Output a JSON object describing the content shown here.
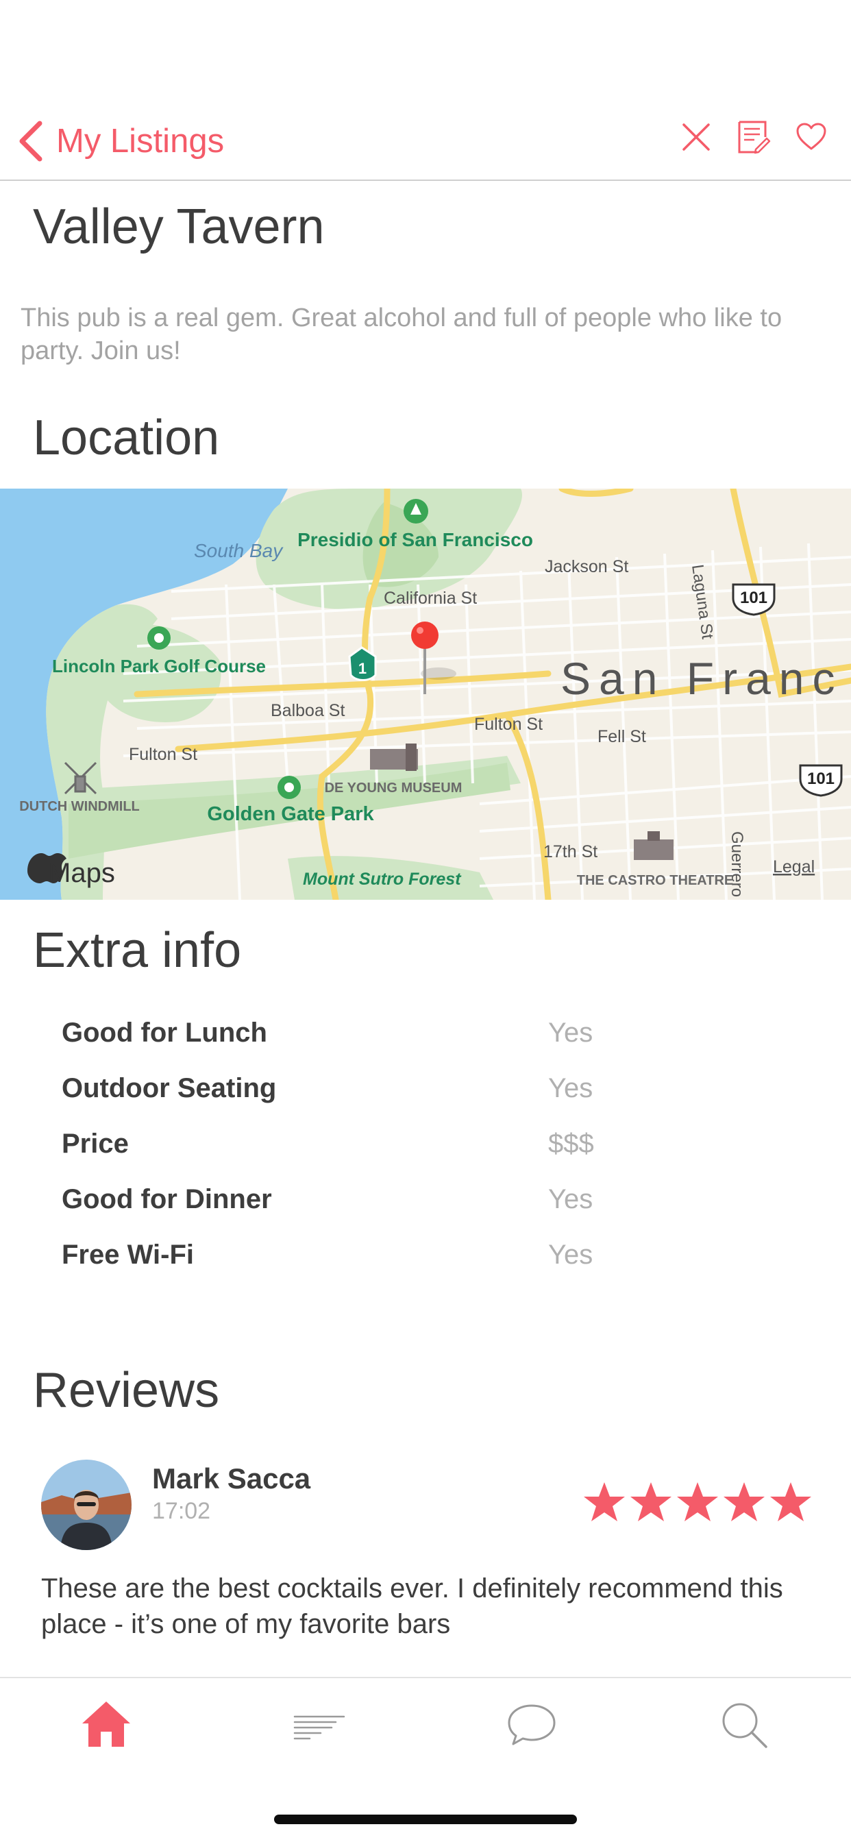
{
  "nav": {
    "back_label": "My Listings",
    "icons": [
      "close-icon",
      "edit-listing-icon",
      "heart-icon"
    ],
    "accent_color": "#f45b69"
  },
  "listing": {
    "title": "Valley Tavern",
    "description": "This pub is a real gem. Great alcohol and full of people who like to party. Join us!"
  },
  "sections": {
    "location": "Location",
    "extra_info": "Extra info",
    "reviews": "Reviews"
  },
  "map": {
    "labels": {
      "south_bay": "South Bay",
      "presidio": "Presidio of San Francisco",
      "jackson": "Jackson St",
      "california": "California St",
      "laguna": "Laguna St",
      "lincoln_park": "Lincoln Park Golf Course",
      "balboa": "Balboa St",
      "san_francisco": "San Franc",
      "fulton_right": "Fulton St",
      "fell": "Fell St",
      "fulton_left": "Fulton St",
      "dutch_windmill": "DUTCH WINDMILL",
      "de_young": "DE YOUNG MUSEUM",
      "golden_gate_park": "Golden Gate Park",
      "seventeenth": "17th St",
      "castro": "THE CASTRO THEATRE",
      "guerrero": "Guerrero",
      "mount_sutro": "Mount Sutro Forest",
      "maps_brand": "Maps",
      "legal": "Legal",
      "route_1": "1",
      "route_101_top": "101",
      "route_101_bottom": "101"
    }
  },
  "extra_info": [
    {
      "label": "Good for Lunch",
      "value": "Yes"
    },
    {
      "label": "Outdoor Seating",
      "value": "Yes"
    },
    {
      "label": "Price",
      "value": "$$$"
    },
    {
      "label": "Good for Dinner",
      "value": "Yes"
    },
    {
      "label": "Free Wi-Fi",
      "value": "Yes"
    }
  ],
  "review": {
    "name": "Mark Sacca",
    "time": "17:02",
    "rating": 5,
    "text": "These are the best cocktails ever. I definitely recommend this place - it’s one of my favorite bars"
  },
  "tabbar": {
    "tabs": [
      "home-icon",
      "feed-icon",
      "chat-icon",
      "search-icon"
    ],
    "active": "home-icon"
  }
}
